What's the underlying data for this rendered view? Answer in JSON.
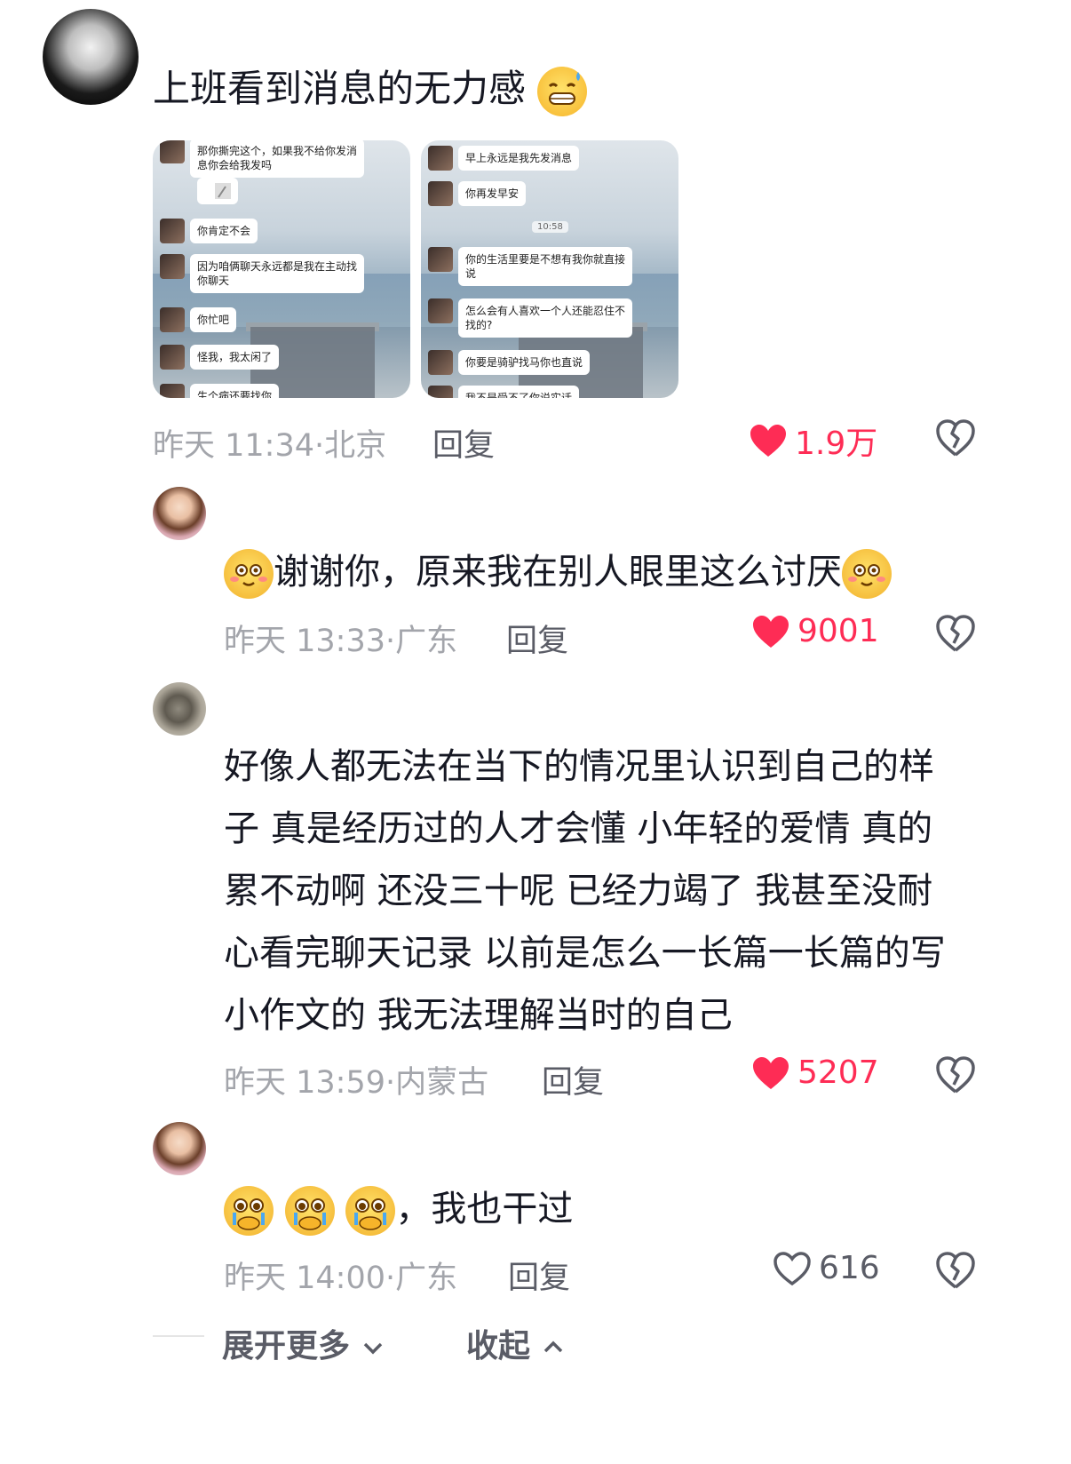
{
  "comments": [
    {
      "text": "上班看到消息的无力感",
      "emoji": "sweat-grin-emoji",
      "time": "昨天 11:34",
      "location": "北京",
      "reply_label": "回复",
      "likes": "1.9万",
      "liked": true,
      "screenshots": [
        {
          "bubbles": [
            "那你撕完这个，如果我不给你发消息你会给我发吗",
            "",
            "你肯定不会",
            "因为咱俩聊天永远都是我在主动找你聊天",
            "你忙吧",
            "怪我，我太闲了",
            "生个病还要找你"
          ]
        },
        {
          "time_pill": "10:58",
          "bubbles": [
            "早上永远是我先发消息",
            "你再发早安",
            "你的生活里要是不想有我你就直接说",
            "怎么会有人喜欢一个人还能忍住不找的?",
            "你要是骑驴找马你也直说",
            "我不是受不了你说实话"
          ]
        }
      ]
    },
    {
      "text": "谢谢你，原来我在别人眼里这么讨厌",
      "time": "昨天 13:33",
      "location": "广东",
      "reply_label": "回复",
      "likes": "9001",
      "liked": true
    },
    {
      "text_lines": [
        "好像人都无法在当下的情况里认识到自己的样",
        "子 真是经历过的人才会懂 小年轻的爱情 真的",
        "累不动啊 还没三十呢 已经力竭了 我甚至没耐",
        "心看完聊天记录 以前是怎么一长篇一长篇的写",
        "小作文的 我无法理解当时的自己"
      ],
      "time": "昨天 13:59",
      "location": "内蒙古",
      "reply_label": "回复",
      "likes": "5207",
      "liked": true
    },
    {
      "text": "，我也干过",
      "time": "昨天 14:00",
      "location": "广东",
      "reply_label": "回复",
      "likes": "616",
      "liked": false
    }
  ],
  "footer": {
    "expand_label": "展开更多",
    "collapse_label": "收起"
  },
  "colors": {
    "like_red": "#fe2c55",
    "meta_gray": "#a3a5ab",
    "text_dark": "#161823"
  }
}
